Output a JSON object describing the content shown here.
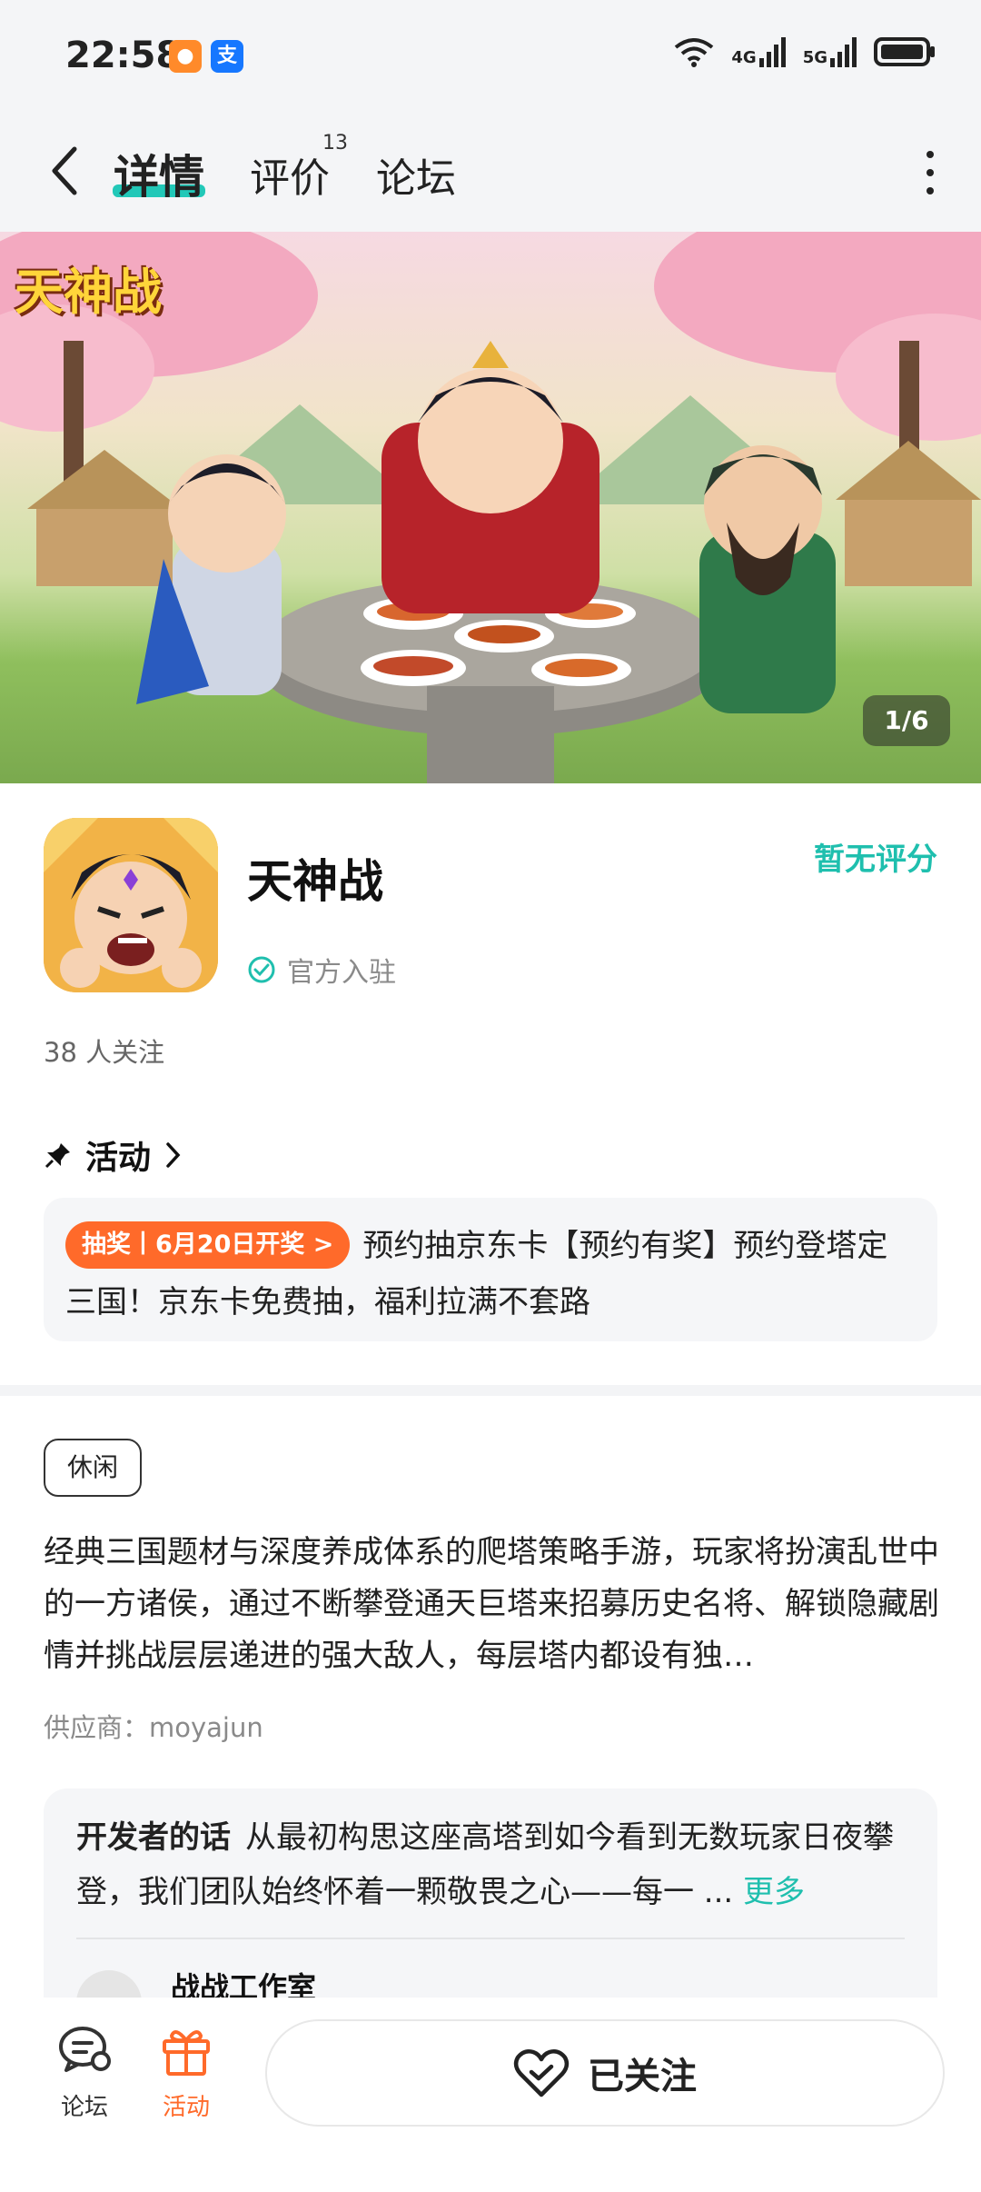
{
  "status_bar": {
    "time": "22:58",
    "net1": "4G",
    "net2": "5G",
    "icons": [
      "message-app-icon",
      "alipay-icon",
      "wifi-icon",
      "signal-icon",
      "battery-icon"
    ]
  },
  "nav": {
    "tabs": [
      {
        "label": "详情",
        "active": true
      },
      {
        "label": "评价",
        "badge": "13"
      },
      {
        "label": "论坛"
      }
    ]
  },
  "banner": {
    "title": "天神战",
    "counter": "1/6"
  },
  "app": {
    "name": "天神战",
    "rating": "暂无评分",
    "official": "官方入驻",
    "followers": "38 人关注"
  },
  "activity": {
    "heading": "活动",
    "tag": "抽奖丨6月20日开奖 >",
    "text": "预约抽京东卡【预约有奖】预约登塔定三国！京东卡免费抽，福利拉满不套路"
  },
  "details": {
    "genre": "休闲",
    "description": "经典三国题材与深度养成体系的爬塔策略手游，玩家将扮演乱世中的一方诸侯，通过不断攀登通天巨塔来招募历史名将、解锁隐藏剧情并挑战层层递进的强大敌人，每层塔内都设有独…",
    "supplier": "供应商：moyajun"
  },
  "developer": {
    "label": "开发者的话",
    "text": "从最初构思这座高塔到如今看到无数玩家日夜攀登，我们团队始终怀着一颗敬畏之心——每一 ...",
    "more": "更多",
    "studio": "战战工作室"
  },
  "bottom_bar": {
    "forum": "论坛",
    "activity": "活动",
    "follow": "已关注"
  },
  "colors": {
    "accent": "#1fbfae",
    "orange": "#ff6a2a"
  }
}
